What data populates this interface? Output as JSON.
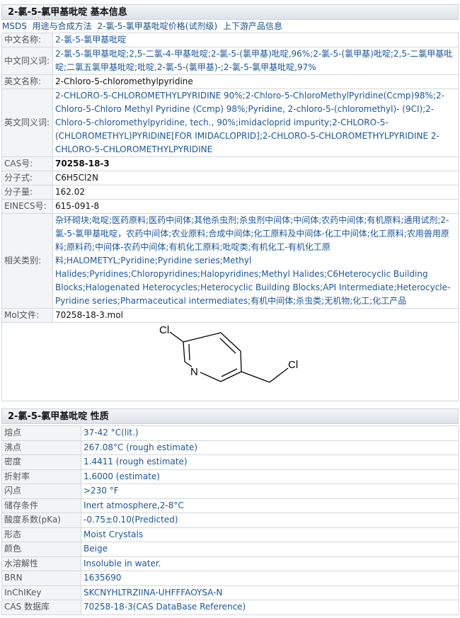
{
  "basic": {
    "header": "2-氯-5-氯甲基吡啶 基本信息",
    "links": [
      "MSDS",
      "用途与合成方法",
      "2-氯-5-氯甲基吡啶价格(试剂级)",
      "上下游产品信息"
    ],
    "rows": {
      "cn_name": {
        "label": "中文名称:",
        "value": "2-氯-5-氯甲基吡啶"
      },
      "cn_syn": {
        "label": "中文同义词:",
        "value": "2-氯-5-氯甲基吡啶;2,5-二氯-4-甲基吡啶;2-氯-5-(氯甲基)吡啶,96%;2-氯-5-(氯甲基)吡啶;2,5-二氯甲基吡啶;二氯五氯甲基吡啶;吡啶,2-氯-5-(氯甲基)-;2-氯-5-氯甲基吡啶,97%"
      },
      "en_name": {
        "label": "英文名称:",
        "value": "2-Chloro-5-chloromethylpyridine"
      },
      "en_syn": {
        "label": "英文同义词:",
        "value": "2-CHLORO-5-CHLOROMETHYLPYRIDINE 90%;2-Chloro-5-ChloroMethylPyridine(Ccmp)98%;2-Chloro-5-Chloro Methyl Pyridine (Ccmp) 98%;Pyridine, 2-chloro-5-(chloromethyl)- (9CI);2-Chloro-5-chloromethylpyridine, tech., 90%;imidacloprid impurity;2-CHLORO-5-(CHLOROMETHYL)PYRIDINE[FOR IMIDACLOPRID];2-CHLORO-5-CHLOROMETHYLPYRIDINE 2-CHLORO-5-CHLOROMETHYLPYRIDINE"
      },
      "cas": {
        "label": "CAS号:",
        "value": "70258-18-3"
      },
      "formula": {
        "label": "分子式:",
        "value": "C6H5Cl2N"
      },
      "mw": {
        "label": "分子量:",
        "value": "162.02"
      },
      "einecs": {
        "label": "EINECS号:",
        "value": "615-091-8"
      },
      "category": {
        "label": "相关类别:",
        "value": "杂环砌块;吡啶;医药原料;医药中间体;其他杀虫剂;杀虫剂中间体;中间体;农药中间体;有机原料;通用试剂;2-氯-5-氯甲基吡啶，农药中间体;农业原料;合成中间体;化工原料及中间体-化工中间体;化工原料;农用兽用原料;原料药;中间体-农药中间体;有机化工原料;吡啶类;有机化工-有机化工原料;HALOMETYL;Pyridine;Pyridine series;Methyl Halides;Pyridines;Chloropyridines;Halopyridines;Methyl Halides;C6Heterocyclic Building Blocks;Halogenated Heterocycles;Heterocyclic Building Blocks;API Intermediate;Heterocycle-Pyridine series;Pharmaceutical intermediates;有机中间体;杀虫类;无机物;化工;化工产品"
      },
      "mol": {
        "label": "Mol文件:",
        "value": "70258-18-3.mol"
      }
    },
    "structure": {
      "atom_cl1": "Cl",
      "atom_n": "N",
      "atom_cl2": "Cl"
    }
  },
  "props": {
    "header": "2-氯-5-氯甲基吡啶 性质",
    "rows": [
      {
        "label": "熔点",
        "value": "37-42 °C(lit.)"
      },
      {
        "label": "沸点",
        "value": "267.08°C (rough estimate)"
      },
      {
        "label": "密度",
        "value": "1.4411 (rough estimate)"
      },
      {
        "label": "折射率",
        "value": "1.6000 (estimate)"
      },
      {
        "label": "闪点",
        "value": ">230 °F"
      },
      {
        "label": "储存条件",
        "value": "Inert atmosphere,2-8°C"
      },
      {
        "label": "酸度系数(pKa)",
        "value": "-0.75±0.10(Predicted)"
      },
      {
        "label": "形态",
        "value": "Moist Crystals"
      },
      {
        "label": "颜色",
        "value": "Beige"
      },
      {
        "label": "水溶解性",
        "value": "Insoluble in water."
      },
      {
        "label": "BRN",
        "value": "1635690"
      },
      {
        "label": "InChIKey",
        "value": "SKCNYHLTRZIINA-UHFFFAOYSA-N"
      },
      {
        "label": "CAS 数据库",
        "value": "70258-18-3(CAS DataBase Reference)"
      }
    ]
  }
}
